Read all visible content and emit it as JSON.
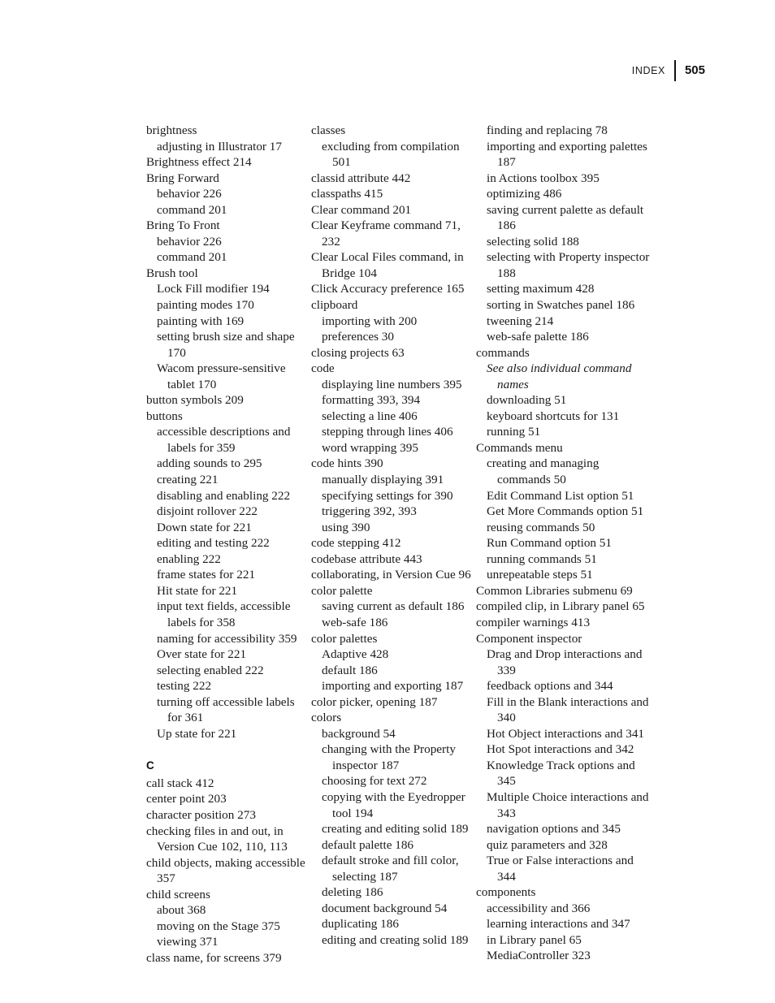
{
  "header": {
    "label": "INDEX",
    "folio": "505"
  },
  "columns": [
    {
      "name": "column-1",
      "blocks": [
        {
          "type": "entries",
          "entries": [
            {
              "level": 0,
              "text": "brightness"
            },
            {
              "level": 1,
              "text": "adjusting in Illustrator 17"
            },
            {
              "level": 0,
              "text": "Brightness effect 214"
            },
            {
              "level": 0,
              "text": "Bring Forward"
            },
            {
              "level": 1,
              "text": "behavior 226"
            },
            {
              "level": 1,
              "text": "command 201"
            },
            {
              "level": 0,
              "text": "Bring To Front"
            },
            {
              "level": 1,
              "text": "behavior 226"
            },
            {
              "level": 1,
              "text": "command 201"
            },
            {
              "level": 0,
              "text": "Brush tool"
            },
            {
              "level": 1,
              "text": "Lock Fill modifier 194"
            },
            {
              "level": 1,
              "text": "painting modes 170"
            },
            {
              "level": 1,
              "text": "painting with 169"
            },
            {
              "level": 1,
              "text": "setting brush size and shape 170"
            },
            {
              "level": 1,
              "text": "Wacom pressure-sensitive tablet 170"
            },
            {
              "level": 0,
              "text": "button symbols 209"
            },
            {
              "level": 0,
              "text": "buttons"
            },
            {
              "level": 1,
              "text": "accessible descriptions and labels for 359"
            },
            {
              "level": 1,
              "text": "adding sounds to 295"
            },
            {
              "level": 1,
              "text": "creating 221"
            },
            {
              "level": 1,
              "text": "disabling and enabling 222"
            },
            {
              "level": 1,
              "text": "disjoint rollover 222"
            },
            {
              "level": 1,
              "text": "Down state for 221"
            },
            {
              "level": 1,
              "text": "editing and testing 222"
            },
            {
              "level": 1,
              "text": "enabling 222"
            },
            {
              "level": 1,
              "text": "frame states for 221"
            },
            {
              "level": 1,
              "text": "Hit state for 221"
            },
            {
              "level": 1,
              "text": "input text fields, accessible labels for 358"
            },
            {
              "level": 1,
              "text": "naming for accessibility 359"
            },
            {
              "level": 1,
              "text": "Over state for 221"
            },
            {
              "level": 1,
              "text": "selecting enabled 222"
            },
            {
              "level": 1,
              "text": "testing 222"
            },
            {
              "level": 1,
              "text": "turning off accessible labels for 361"
            },
            {
              "level": 1,
              "text": "Up state for 221"
            }
          ]
        },
        {
          "type": "letter",
          "letter": "C"
        },
        {
          "type": "entries",
          "entries": [
            {
              "level": 0,
              "text": "call stack 412"
            },
            {
              "level": 0,
              "text": "center point 203"
            },
            {
              "level": 0,
              "text": "character position 273"
            },
            {
              "level": 0,
              "text": "checking files in and out, in Version Cue 102, 110, 113"
            },
            {
              "level": 0,
              "text": "child objects, making accessible 357"
            },
            {
              "level": 0,
              "text": "child screens"
            },
            {
              "level": 1,
              "text": "about 368"
            },
            {
              "level": 1,
              "text": "moving on the Stage 375"
            },
            {
              "level": 1,
              "text": "viewing 371"
            },
            {
              "level": 0,
              "text": "class name, for screens 379"
            }
          ]
        }
      ]
    },
    {
      "name": "column-2",
      "blocks": [
        {
          "type": "entries",
          "entries": [
            {
              "level": 0,
              "text": "classes"
            },
            {
              "level": 1,
              "text": "excluding from compilation 501"
            },
            {
              "level": 0,
              "text": "classid attribute 442"
            },
            {
              "level": 0,
              "text": "classpaths 415"
            },
            {
              "level": 0,
              "text": "Clear command 201"
            },
            {
              "level": 0,
              "text": "Clear Keyframe command 71, 232"
            },
            {
              "level": 0,
              "text": "Clear Local Files command, in Bridge 104"
            },
            {
              "level": 0,
              "text": "Click Accuracy preference 165"
            },
            {
              "level": 0,
              "text": "clipboard"
            },
            {
              "level": 1,
              "text": "importing with 200"
            },
            {
              "level": 1,
              "text": "preferences 30"
            },
            {
              "level": 0,
              "text": "closing projects 63"
            },
            {
              "level": 0,
              "text": "code"
            },
            {
              "level": 1,
              "text": "displaying line numbers 395"
            },
            {
              "level": 1,
              "text": "formatting 393, 394"
            },
            {
              "level": 1,
              "text": "selecting a line 406"
            },
            {
              "level": 1,
              "text": "stepping through lines 406"
            },
            {
              "level": 1,
              "text": "word wrapping 395"
            },
            {
              "level": 0,
              "text": "code hints 390"
            },
            {
              "level": 1,
              "text": "manually displaying 391"
            },
            {
              "level": 1,
              "text": "specifying settings for 390"
            },
            {
              "level": 1,
              "text": "triggering 392, 393"
            },
            {
              "level": 1,
              "text": "using 390"
            },
            {
              "level": 0,
              "text": "code stepping 412"
            },
            {
              "level": 0,
              "text": "codebase attribute 443"
            },
            {
              "level": 0,
              "text": "collaborating, in Version Cue 96"
            },
            {
              "level": 0,
              "text": "color palette"
            },
            {
              "level": 1,
              "text": "saving current as default 186"
            },
            {
              "level": 1,
              "text": "web-safe 186"
            },
            {
              "level": 0,
              "text": "color palettes"
            },
            {
              "level": 1,
              "text": "Adaptive 428"
            },
            {
              "level": 1,
              "text": "default 186"
            },
            {
              "level": 1,
              "text": "importing and exporting 187"
            },
            {
              "level": 0,
              "text": "color picker, opening 187"
            },
            {
              "level": 0,
              "text": "colors"
            },
            {
              "level": 1,
              "text": "background 54"
            },
            {
              "level": 1,
              "text": "changing with the Property inspector 187"
            },
            {
              "level": 1,
              "text": "choosing for text 272"
            },
            {
              "level": 1,
              "text": "copying with the Eyedropper tool 194"
            },
            {
              "level": 1,
              "text": "creating and editing solid 189"
            },
            {
              "level": 1,
              "text": "default palette 186"
            },
            {
              "level": 1,
              "text": "default stroke and fill color, selecting 187"
            },
            {
              "level": 1,
              "text": "deleting 186"
            },
            {
              "level": 1,
              "text": "document background 54"
            },
            {
              "level": 1,
              "text": "duplicating 186"
            },
            {
              "level": 1,
              "text": "editing and creating solid 189"
            }
          ]
        }
      ]
    },
    {
      "name": "column-3",
      "blocks": [
        {
          "type": "entries",
          "entries": [
            {
              "level": 1,
              "text": "finding and replacing 78"
            },
            {
              "level": 1,
              "text": "importing and exporting palettes 187"
            },
            {
              "level": 1,
              "text": "in Actions toolbox 395"
            },
            {
              "level": 1,
              "text": "optimizing 486"
            },
            {
              "level": 1,
              "text": "saving current palette as default 186"
            },
            {
              "level": 1,
              "text": "selecting solid 188"
            },
            {
              "level": 1,
              "text": "selecting with Property inspector 188"
            },
            {
              "level": 1,
              "text": "setting maximum 428"
            },
            {
              "level": 1,
              "text": "sorting in Swatches panel 186"
            },
            {
              "level": 1,
              "text": "tweening 214"
            },
            {
              "level": 1,
              "text": "web-safe palette 186"
            },
            {
              "level": 0,
              "text": "commands"
            },
            {
              "level": 1,
              "text": "See also individual command names",
              "italic": true
            },
            {
              "level": 1,
              "text": "downloading 51"
            },
            {
              "level": 1,
              "text": "keyboard shortcuts for 131"
            },
            {
              "level": 1,
              "text": "running 51"
            },
            {
              "level": 0,
              "text": "Commands menu"
            },
            {
              "level": 1,
              "text": "creating and managing commands 50"
            },
            {
              "level": 1,
              "text": "Edit Command List option 51"
            },
            {
              "level": 1,
              "text": "Get More Commands option 51"
            },
            {
              "level": 1,
              "text": "reusing commands 50"
            },
            {
              "level": 1,
              "text": "Run Command option 51"
            },
            {
              "level": 1,
              "text": "running commands 51"
            },
            {
              "level": 1,
              "text": "unrepeatable steps 51"
            },
            {
              "level": 0,
              "text": "Common Libraries submenu 69"
            },
            {
              "level": 0,
              "text": "compiled clip, in Library panel 65"
            },
            {
              "level": 0,
              "text": "compiler warnings 413"
            },
            {
              "level": 0,
              "text": "Component inspector"
            },
            {
              "level": 1,
              "text": "Drag and Drop interactions and 339"
            },
            {
              "level": 1,
              "text": "feedback options and 344"
            },
            {
              "level": 1,
              "text": "Fill in the Blank interactions and 340"
            },
            {
              "level": 1,
              "text": "Hot Object interactions and 341"
            },
            {
              "level": 1,
              "text": "Hot Spot interactions and 342"
            },
            {
              "level": 1,
              "text": "Knowledge Track options and 345"
            },
            {
              "level": 1,
              "text": "Multiple Choice interactions and 343"
            },
            {
              "level": 1,
              "text": "navigation options and 345"
            },
            {
              "level": 1,
              "text": "quiz parameters and 328"
            },
            {
              "level": 1,
              "text": "True or False interactions and 344"
            },
            {
              "level": 0,
              "text": "components"
            },
            {
              "level": 1,
              "text": "accessibility and 366"
            },
            {
              "level": 1,
              "text": "learning interactions and 347"
            },
            {
              "level": 1,
              "text": "in Library panel 65"
            },
            {
              "level": 1,
              "text": "MediaController 323"
            }
          ]
        }
      ]
    }
  ]
}
